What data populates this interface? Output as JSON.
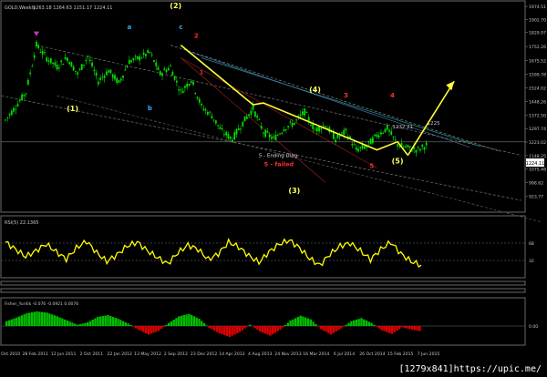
{
  "window": {
    "symbol_title": "GOLD,Weekly",
    "ohlc": "1263.18 1264.63 1151.17 1224.11"
  },
  "watermark": "[1279x841]https://upic.me/",
  "colors": {
    "background": "#000000",
    "candle": "#00e000",
    "rsi_line": "#ffff00",
    "wave_labels": "#ffff66",
    "red_label": "#ff3030",
    "blue_label": "#33aaff",
    "channel_dash": "#808080",
    "fisher_pos": "#00c000",
    "fisher_neg": "#e00000",
    "projection": "#ffff33"
  },
  "chart_data": [
    {
      "type": "line",
      "name": "price",
      "title": "GOLD,Weekly",
      "x": [
        "31 Oct 2010",
        "28 Feb 2011",
        "12 Jun 2011",
        "2 Oct 2011",
        "22 Jan 2012",
        "13 May 2012",
        "2 Sep 2012",
        "23 Dec 2012",
        "14 Apr 2013",
        "4 Aug 2013",
        "24 Nov 2013",
        "16 Mar 2014",
        "6 Jul 2014",
        "26 Oct 2014",
        "15 Feb 2015",
        "7 Jun 2015"
      ],
      "series": [
        {
          "values": [
            1345,
            1420,
            1500,
            1760,
            1690,
            1640,
            1690,
            1600,
            1700,
            1560,
            1620,
            1550,
            1670,
            1690,
            1720,
            1600,
            1640,
            1500,
            1570,
            1420,
            1370,
            1280,
            1240,
            1330,
            1410,
            1280,
            1240,
            1300,
            1330,
            1390,
            1290,
            1320,
            1240,
            1280,
            1180,
            1200,
            1260,
            1300,
            1210,
            1190,
            1180,
            1214
          ]
        }
      ],
      "ylim": [
        850,
        1990
      ],
      "y_ticks": [
        "1974.51",
        "1902.70",
        "1829.97",
        "1752.26",
        "1675.52",
        "1599.78",
        "1524.02",
        "1448.26",
        "1372.50",
        "1297.74",
        "1223.02",
        "1148.25",
        "1075.48",
        "998.62",
        "923.77"
      ],
      "current_price": "1224.11",
      "annotations": {
        "wave_labels": [
          "(1)",
          "(2)",
          "(3)",
          "(4)",
          "(5)"
        ],
        "abc_labels": [
          "a",
          "b",
          "c"
        ],
        "red_numbers": [
          "1",
          "2",
          "3",
          "4",
          "5"
        ],
        "levels": [
          "1232 21",
          "1225"
        ],
        "notes": [
          "5 - Ending Diag.",
          "5 - failed"
        ]
      }
    },
    {
      "type": "line",
      "name": "RSI(5) 22.1365",
      "title": "RSI(5) 22.1365",
      "ylim": [
        0,
        100
      ],
      "levels": [
        68,
        32
      ],
      "y_ticks": [
        "68",
        "32"
      ],
      "series": [
        {
          "values": [
            70,
            55,
            40,
            52,
            66,
            50,
            35,
            58,
            72,
            48,
            30,
            44,
            62,
            70,
            52,
            38,
            25,
            48,
            64,
            55,
            34,
            46,
            70,
            60,
            42,
            28,
            50,
            66,
            74,
            58,
            36,
            22,
            45,
            62,
            68,
            52,
            34,
            55,
            70,
            46,
            30,
            22
          ]
        }
      ]
    },
    {
      "type": "bar",
      "name": "Fisher",
      "title": "Fisher_Yur4ik -0.076 -0.0921 0.0076",
      "ylim": [
        -3,
        3
      ],
      "y_ticks": [
        "0.00"
      ],
      "series": [
        {
          "values": [
            0.8,
            1.4,
            2.1,
            2.4,
            2.2,
            1.6,
            0.9,
            0.2,
            0.6,
            1.5,
            1.8,
            1.2,
            0.4,
            -0.6,
            -1.4,
            -0.8,
            0.5,
            1.6,
            2.0,
            1.2,
            -0.3,
            -1.2,
            -1.8,
            -1.0,
            0.2,
            -0.9,
            -1.6,
            -0.6,
            0.9,
            1.7,
            1.1,
            -0.5,
            -1.4,
            -0.4,
            0.8,
            1.3,
            0.5,
            -0.7,
            -1.3,
            -0.2,
            -0.6,
            -0.9
          ]
        }
      ]
    }
  ]
}
